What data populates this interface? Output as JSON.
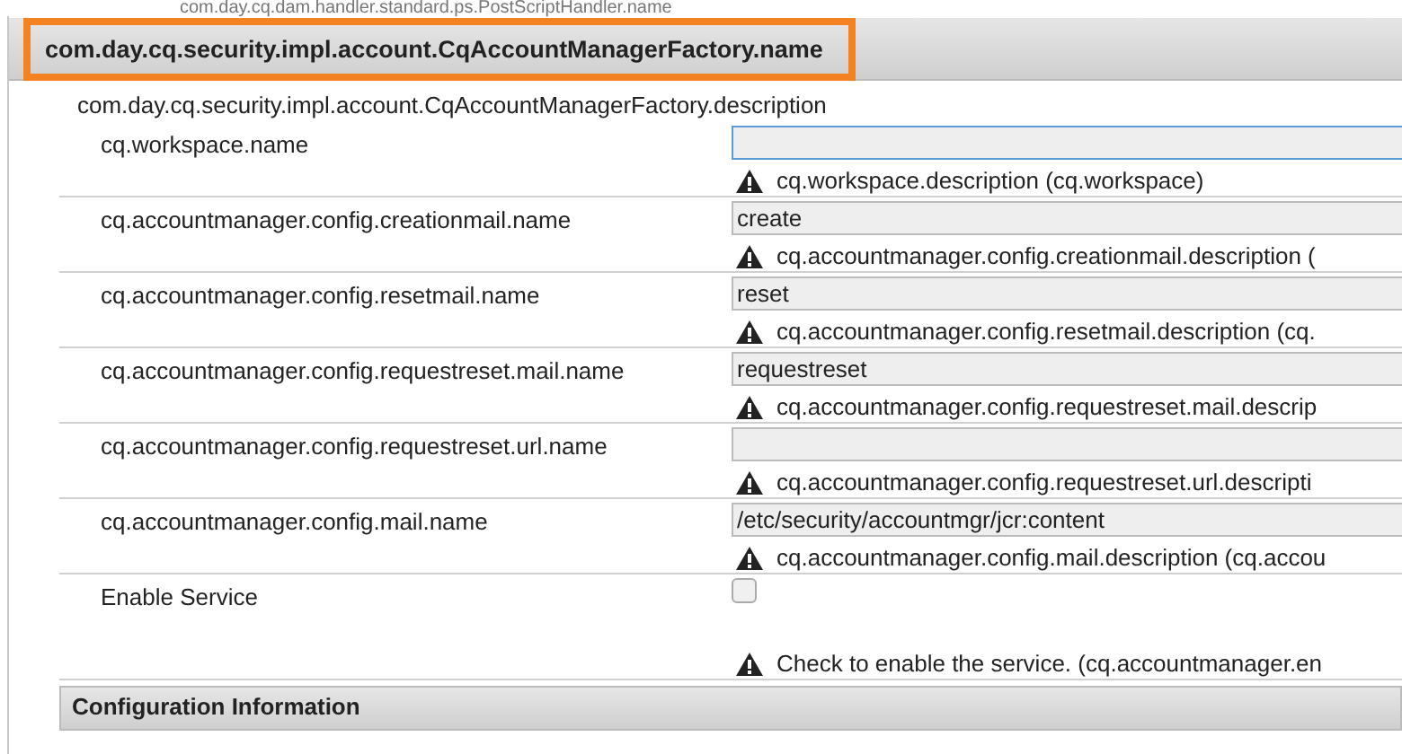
{
  "previous_item": "com.day.cq.dam.handler.standard.ps.PostScriptHandler.name",
  "panel": {
    "title": "com.day.cq.security.impl.account.CqAccountManagerFactory.name",
    "highlighted": true,
    "description": "com.day.cq.security.impl.account.CqAccountManagerFactory.description"
  },
  "rows": [
    {
      "kind": "text",
      "label": "cq.workspace.name",
      "value": "",
      "focused": true,
      "description": "cq.workspace.description (cq.workspace)"
    },
    {
      "kind": "text",
      "label": "cq.accountmanager.config.creationmail.name",
      "value": "create",
      "focused": false,
      "description": "cq.accountmanager.config.creationmail.description ("
    },
    {
      "kind": "text",
      "label": "cq.accountmanager.config.resetmail.name",
      "value": "reset",
      "focused": false,
      "description": "cq.accountmanager.config.resetmail.description (cq."
    },
    {
      "kind": "text",
      "label": "cq.accountmanager.config.requestreset.mail.name",
      "value": "requestreset",
      "focused": false,
      "description": "cq.accountmanager.config.requestreset.mail.descrip"
    },
    {
      "kind": "text",
      "label": "cq.accountmanager.config.requestreset.url.name",
      "value": "",
      "focused": false,
      "description": "cq.accountmanager.config.requestreset.url.descripti"
    },
    {
      "kind": "text",
      "label": "cq.accountmanager.config.mail.name",
      "value": "/etc/security/accountmgr/jcr:content",
      "focused": false,
      "description": "cq.accountmanager.config.mail.description (cq.accou"
    },
    {
      "kind": "checkbox",
      "label": "Enable Service",
      "checked": false,
      "description": "Check to enable the service. (cq.accountmanager.en"
    }
  ],
  "next_section": {
    "title": "Configuration Information"
  }
}
